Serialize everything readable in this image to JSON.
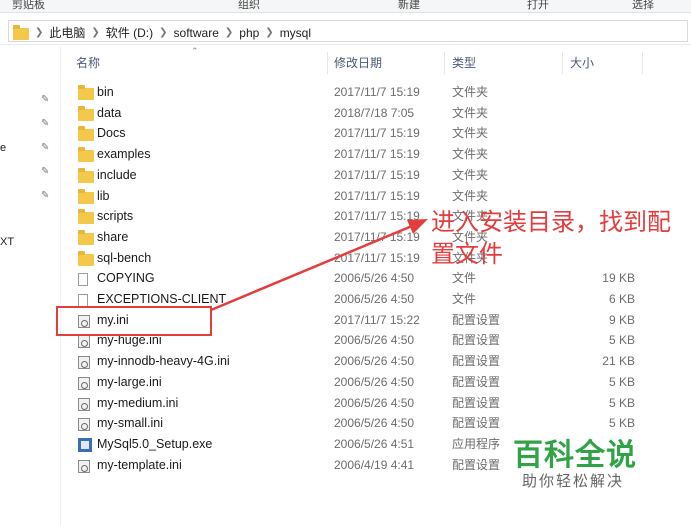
{
  "ribbon": {
    "groups": [
      "剪贴板",
      "组织",
      "新建",
      "打开",
      "选择"
    ]
  },
  "address": {
    "crumbs": [
      "此电脑",
      "软件 (D:)",
      "software",
      "php",
      "mysql"
    ]
  },
  "nav": {
    "fragments": [
      "e",
      "XT"
    ]
  },
  "columns": {
    "name": "名称",
    "date": "修改日期",
    "type": "类型",
    "size": "大小"
  },
  "files": [
    {
      "name": "bin",
      "date": "2017/11/7 15:19",
      "type": "文件夹",
      "size": "",
      "icon": "folder-icon"
    },
    {
      "name": "data",
      "date": "2018/7/18 7:05",
      "type": "文件夹",
      "size": "",
      "icon": "folder-icon"
    },
    {
      "name": "Docs",
      "date": "2017/11/7 15:19",
      "type": "文件夹",
      "size": "",
      "icon": "folder-icon"
    },
    {
      "name": "examples",
      "date": "2017/11/7 15:19",
      "type": "文件夹",
      "size": "",
      "icon": "folder-icon"
    },
    {
      "name": "include",
      "date": "2017/11/7 15:19",
      "type": "文件夹",
      "size": "",
      "icon": "folder-icon"
    },
    {
      "name": "lib",
      "date": "2017/11/7 15:19",
      "type": "文件夹",
      "size": "",
      "icon": "folder-icon"
    },
    {
      "name": "scripts",
      "date": "2017/11/7 15:19",
      "type": "文件夹",
      "size": "",
      "icon": "folder-icon"
    },
    {
      "name": "share",
      "date": "2017/11/7 15:19",
      "type": "文件夹",
      "size": "",
      "icon": "folder-icon"
    },
    {
      "name": "sql-bench",
      "date": "2017/11/7 15:19",
      "type": "文件夹",
      "size": "",
      "icon": "folder-icon"
    },
    {
      "name": "COPYING",
      "date": "2006/5/26 4:50",
      "type": "文件",
      "size": "19 KB",
      "icon": "file-icon"
    },
    {
      "name": "EXCEPTIONS-CLIENT",
      "date": "2006/5/26 4:50",
      "type": "文件",
      "size": "6 KB",
      "icon": "file-icon"
    },
    {
      "name": "my.ini",
      "date": "2017/11/7 15:22",
      "type": "配置设置",
      "size": "9 KB",
      "icon": "settings-file-icon"
    },
    {
      "name": "my-huge.ini",
      "date": "2006/5/26 4:50",
      "type": "配置设置",
      "size": "5 KB",
      "icon": "settings-file-icon"
    },
    {
      "name": "my-innodb-heavy-4G.ini",
      "date": "2006/5/26 4:50",
      "type": "配置设置",
      "size": "21 KB",
      "icon": "settings-file-icon"
    },
    {
      "name": "my-large.ini",
      "date": "2006/5/26 4:50",
      "type": "配置设置",
      "size": "5 KB",
      "icon": "settings-file-icon"
    },
    {
      "name": "my-medium.ini",
      "date": "2006/5/26 4:50",
      "type": "配置设置",
      "size": "5 KB",
      "icon": "settings-file-icon"
    },
    {
      "name": "my-small.ini",
      "date": "2006/5/26 4:50",
      "type": "配置设置",
      "size": "5 KB",
      "icon": "settings-file-icon"
    },
    {
      "name": "MySql5.0_Setup.exe",
      "date": "2006/5/26 4:51",
      "type": "应用程序",
      "size": "",
      "icon": "installer-icon"
    },
    {
      "name": "my-template.ini",
      "date": "2006/4/19 4:41",
      "type": "配置设置",
      "size": "",
      "icon": "settings-file-icon"
    }
  ],
  "annotation": {
    "text": "进入安装目录，找到配置文件",
    "color": "#e43d3d"
  },
  "watermark": {
    "title": "百科全说",
    "subtitle": "助你轻松解决",
    "color": "#2fa346"
  }
}
